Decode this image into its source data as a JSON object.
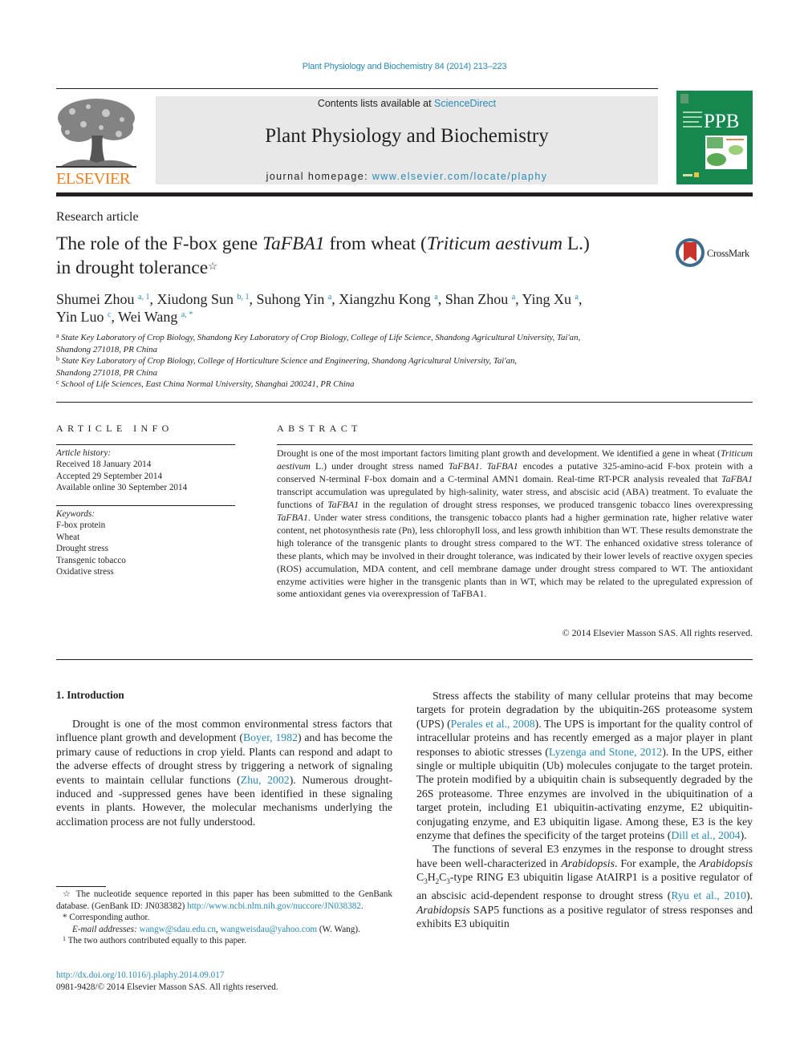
{
  "header": {
    "citation": "Plant Physiology and Biochemistry 84 (2014) 213–223",
    "publisher_logo_text": "ELSEVIER",
    "contents_prefix": "Contents lists available at ",
    "contents_link": "ScienceDirect",
    "journal_title": "Plant Physiology and Biochemistry",
    "homepage_prefix": "journal homepage: ",
    "homepage_link": "www.elsevier.com/locate/plaphy",
    "cover_label": "PPB",
    "colors": {
      "link": "#2a8ab5",
      "elsevier_orange": "#f07f20",
      "cover_green": "#178750",
      "masthead_gray": "#e8e8e8"
    }
  },
  "article": {
    "type": "Research article",
    "title_parts": {
      "p1": "The role of the F-box gene ",
      "gene": "TaFBA1",
      "p2": " from wheat (",
      "species": "Triticum aestivum",
      "p3": " L.)",
      "p4": "in drought tolerance",
      "star": "☆"
    },
    "crossmark_label": "CrossMark",
    "authors": [
      {
        "name": "Shumei Zhou",
        "sup": "a, 1"
      },
      {
        "name": "Xiudong Sun",
        "sup": "b, 1"
      },
      {
        "name": "Suhong Yin",
        "sup": "a"
      },
      {
        "name": "Xiangzhu Kong",
        "sup": "a"
      },
      {
        "name": "Shan Zhou",
        "sup": "a"
      },
      {
        "name": "Ying Xu",
        "sup": "a"
      },
      {
        "name": "Yin Luo",
        "sup": "c"
      },
      {
        "name": "Wei Wang",
        "sup": "a, *"
      }
    ],
    "affiliations": [
      {
        "key": "a",
        "line1": "State Key Laboratory of Crop Biology, Shandong Key Laboratory of Crop Biology, College of Life Science, Shandong Agricultural University, Tai'an,",
        "line2": "Shandong 271018, PR China"
      },
      {
        "key": "b",
        "line1": "State Key Laboratory of Crop Biology, College of Horticulture Science and Engineering, Shandong Agricultural University, Tai'an,",
        "line2": "Shandong 271018, PR China"
      },
      {
        "key": "c",
        "line1": "School of Life Sciences, East China Normal University, Shanghai 200241, PR China",
        "line2": ""
      }
    ]
  },
  "article_info": {
    "heading": "ARTICLE INFO",
    "history_label": "Article history:",
    "history": [
      "Received 18 January 2014",
      "Accepted 29 September 2014",
      "Available online 30 September 2014"
    ],
    "keywords_label": "Keywords:",
    "keywords": [
      "F-box protein",
      "Wheat",
      "Drought stress",
      "Transgenic tobacco",
      "Oxidative stress"
    ]
  },
  "abstract": {
    "heading": "ABSTRACT",
    "s1": "Drought is one of the most important factors limiting plant growth and development. We identified a gene in wheat (",
    "s1_species": "Triticum aestivum",
    "s2": " L.) under drought stress named ",
    "gene": "TaFBA1",
    "s3": ". ",
    "s4": " encodes a putative 325-amino-acid F-box protein with a conserved N-terminal F-box domain and a C-terminal AMN1 domain. Real-time RT-PCR analysis revealed that ",
    "s5": " transcript accumulation was upregulated by high-salinity, water stress, and abscisic acid (ABA) treatment. To evaluate the functions of ",
    "s6": " in the regulation of drought stress responses, we produced transgenic tobacco lines overexpressing ",
    "s7": ". Under water stress conditions, the transgenic tobacco plants had a higher germination rate, higher relative water content, net photosynthesis rate (Pn), less chlorophyll loss, and less growth inhibition than WT. These results demonstrate the high tolerance of the transgenic plants to drought stress compared to the WT. The enhanced oxidative stress tolerance of these plants, which may be involved in their drought tolerance, was indicated by their lower levels of reactive oxygen species (ROS) accumulation, MDA content, and cell membrane damage under drought stress compared to WT. The antioxidant enzyme activities were higher in the transgenic plants than in WT, which may be related to the upregulated expression of some antioxidant genes via overexpression of TaFBA1.",
    "copyright": "© 2014 Elsevier Masson SAS. All rights reserved."
  },
  "body": {
    "intro_heading": "1.  Introduction",
    "left_p1": {
      "a": "Drought is one of the most common environmental stress factors that influence plant growth and development (",
      "ref1": "Boyer, 1982",
      "b": ") and has become the primary cause of reductions in crop yield. Plants can respond and adapt to the adverse effects of drought stress by triggering a network of signaling events to maintain cellular functions (",
      "ref2": "Zhu, 2002",
      "c": "). Numerous drought-induced and -suppressed genes have been identified in these signaling events in plants. However, the molecular mechanisms underlying the acclimation process are not fully understood."
    },
    "right_p1": {
      "a": "Stress affects the stability of many cellular proteins that may become targets for protein degradation by the ubiquitin-26S proteasome system (UPS) (",
      "ref1": "Perales et al., 2008",
      "b": "). The UPS is important for the quality control of intracellular proteins and has recently emerged as a major player in plant responses to abiotic stresses (",
      "ref2": "Lyzenga and Stone, 2012",
      "c": "). In the UPS, either single or multiple ubiquitin (Ub) molecules conjugate to the target protein. The protein modified by a ubiquitin chain is subsequently degraded by the 26S proteasome. Three enzymes are involved in the ubiquitination of a target protein, including E1 ubiquitin-activating enzyme, E2 ubiquitin-conjugating enzyme, and E3 ubiquitin ligase. Among these, E3 is the key enzyme that defines the specificity of the target proteins (",
      "ref3": "Dill et al., 2004",
      "d": ")."
    },
    "right_p2": {
      "a": "The functions of several E3 enzymes in the response to drought stress have been well-characterized in ",
      "arab": "Arabidopsis",
      "b": ". For example, the ",
      "c": " C",
      "c_sub1": "3",
      "c2": "H",
      "c_sub2": "2",
      "c3": "C",
      "c_sub3": "3",
      "d": "-type RING E3 ubiquitin ligase AtAIRP1 is a positive regulator of an abscisic acid-dependent response to drought stress (",
      "ref1": "Ryu et al., 2010",
      "e": "). ",
      "f": " SAP5 functions as a positive regulator of stress responses and exhibits E3 ubiquitin"
    }
  },
  "footnotes": {
    "star_mark": "☆",
    "star_text": " The nucleotide sequence reported in this paper has been submitted to the GenBank database. (GenBank ID: JN038382) ",
    "star_link": "http://www.ncbi.nlm.nih.gov/nuccore/JN038382",
    "star_end": ".",
    "corr_mark": "*",
    "corr_text": " Corresponding author.",
    "email_label": "E-mail addresses:",
    "email1": "wangw@sdau.edu.cn",
    "email_sep": ", ",
    "email2": "wangweisdau@yahoo.com",
    "email_end": " (W. Wang).",
    "one_mark": "1",
    "one_text": " The two authors contributed equally to this paper.",
    "doi": "http://dx.doi.org/10.1016/j.plaphy.2014.09.017",
    "issn": "0981-9428/© 2014 Elsevier Masson SAS. All rights reserved."
  }
}
